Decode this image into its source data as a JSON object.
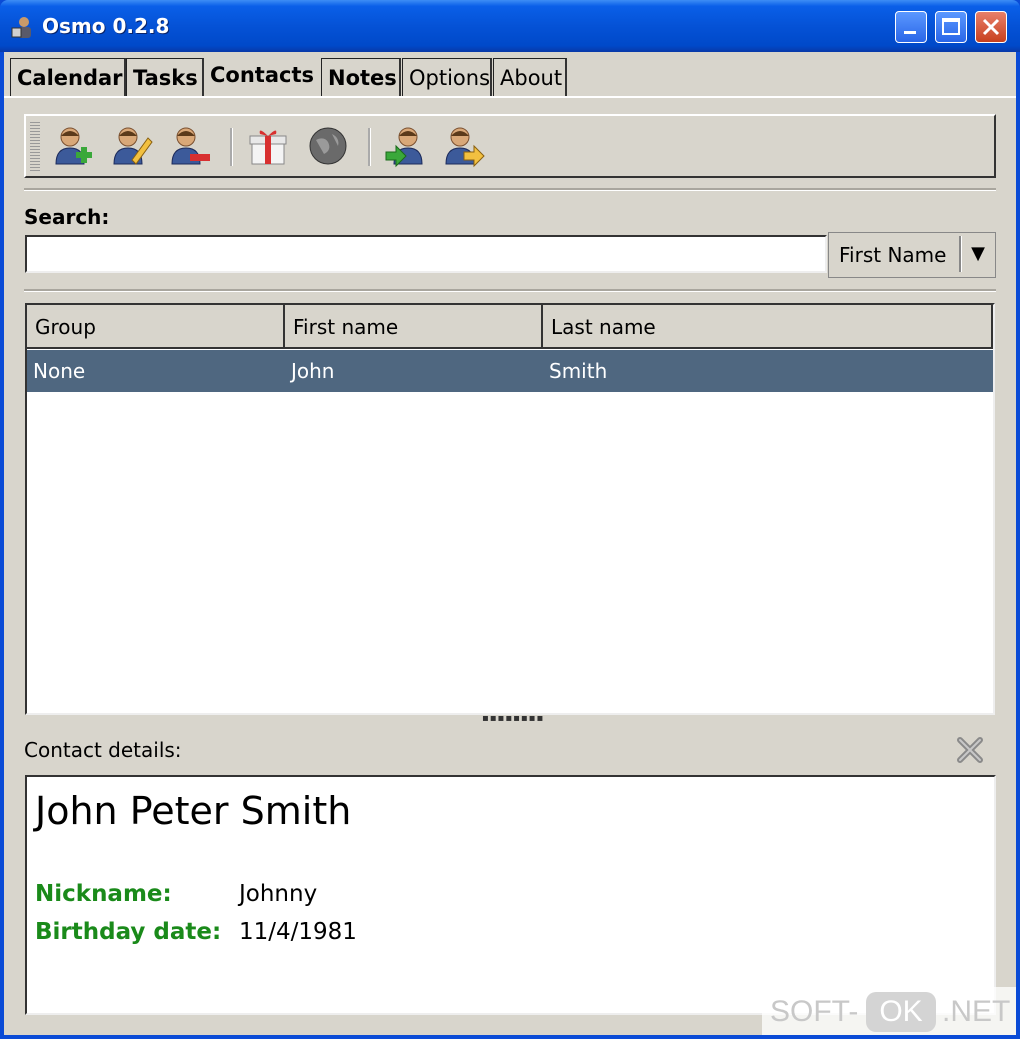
{
  "window": {
    "title": "Osmo 0.2.8"
  },
  "tabs": [
    {
      "label": "Calendar"
    },
    {
      "label": "Tasks"
    },
    {
      "label": "Contacts"
    },
    {
      "label": "Notes"
    },
    {
      "label": "Options"
    },
    {
      "label": "About"
    }
  ],
  "active_tab": "Contacts",
  "toolbar": {
    "icons": [
      "add-contact-icon",
      "edit-contact-icon",
      "remove-contact-icon",
      "gift-icon",
      "globe-icon",
      "import-contact-icon",
      "export-contact-icon"
    ]
  },
  "search": {
    "label": "Search:",
    "value": "",
    "field_option": "First Name"
  },
  "contacts_table": {
    "headers": [
      "Group",
      "First name",
      "Last name"
    ],
    "rows": [
      {
        "group": "None",
        "first_name": "John",
        "last_name": "Smith"
      }
    ]
  },
  "details": {
    "label": "Contact details:",
    "full_name": "John Peter Smith",
    "nickname_label": "Nickname:",
    "nickname": "Johnny",
    "birthday_label": "Birthday date:",
    "birthday": "11/4/1981"
  },
  "watermark": {
    "left": "SOFT-",
    "middle": "OK",
    "right": ".NET"
  },
  "colors": {
    "selection": "#4f6780",
    "field_label": "#1a8a1a",
    "titlebar": "#0552d6"
  }
}
